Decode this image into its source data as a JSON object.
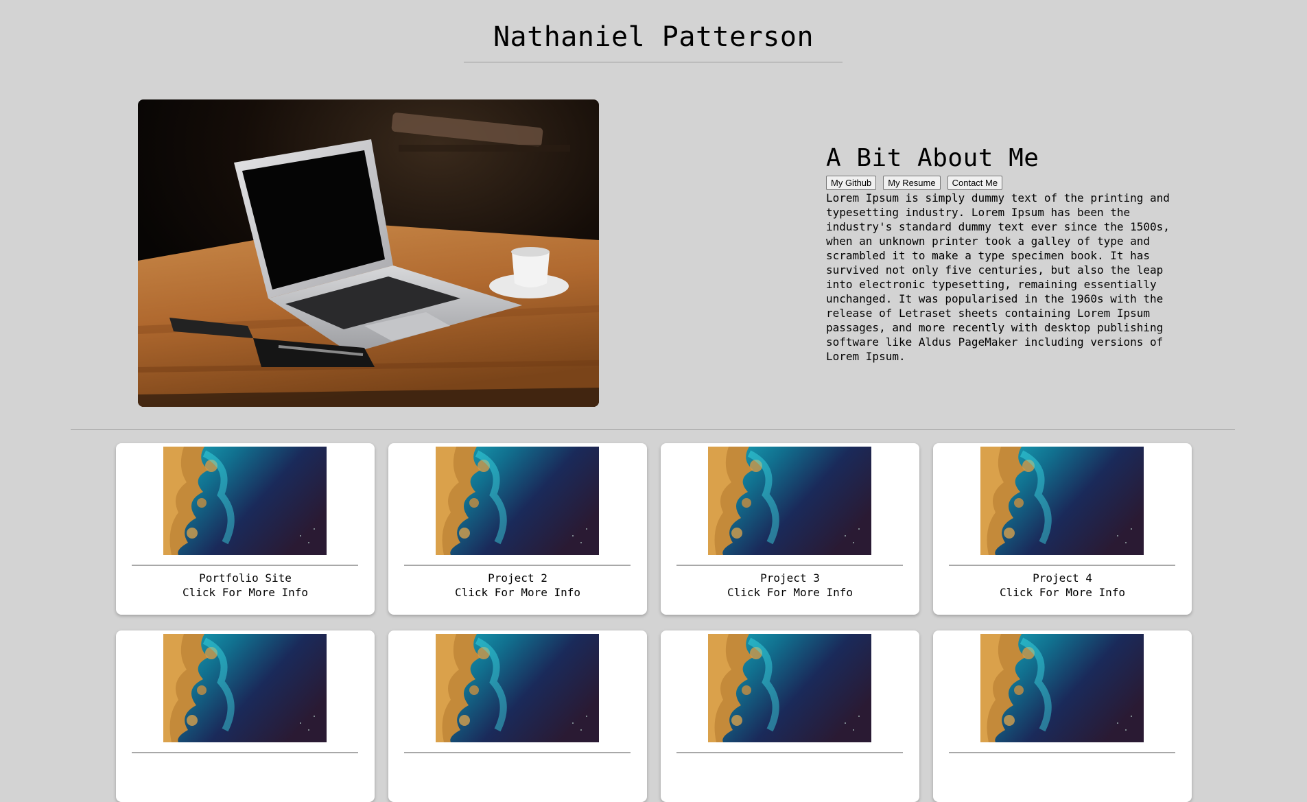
{
  "header": {
    "title": "Nathaniel Patterson"
  },
  "about": {
    "heading": "A Bit About Me",
    "buttons": [
      "My Github",
      "My Resume",
      "Contact Me"
    ],
    "text": "Lorem Ipsum is simply dummy text of the printing and\ntypesetting industry. Lorem Ipsum has been the\nindustry's standard dummy text ever since the 1500s,\nwhen an unknown printer took a galley of type and\nscrambled it to make a type specimen book. It has\nsurvived not only five centuries, but also the leap\ninto electronic typesetting, remaining essentially\nunchanged. It was popularised in the 1960s with the\nrelease of Letraset sheets containing Lorem Ipsum\npassages, and more recently with desktop publishing\nsoftware like Aldus PageMaker including versions of\nLorem Ipsum."
  },
  "projects": [
    {
      "title": "Portfolio Site",
      "subtitle": "Click For More Info"
    },
    {
      "title": "Project 2",
      "subtitle": "Click For More Info"
    },
    {
      "title": "Project 3",
      "subtitle": "Click For More Info"
    },
    {
      "title": "Project 4",
      "subtitle": "Click For More Info"
    },
    {
      "title": "",
      "subtitle": ""
    },
    {
      "title": "",
      "subtitle": ""
    },
    {
      "title": "",
      "subtitle": ""
    },
    {
      "title": "",
      "subtitle": ""
    }
  ],
  "colors": {
    "background": "#d3d3d3",
    "card": "#ffffff",
    "rule": "#9a9a9a"
  }
}
